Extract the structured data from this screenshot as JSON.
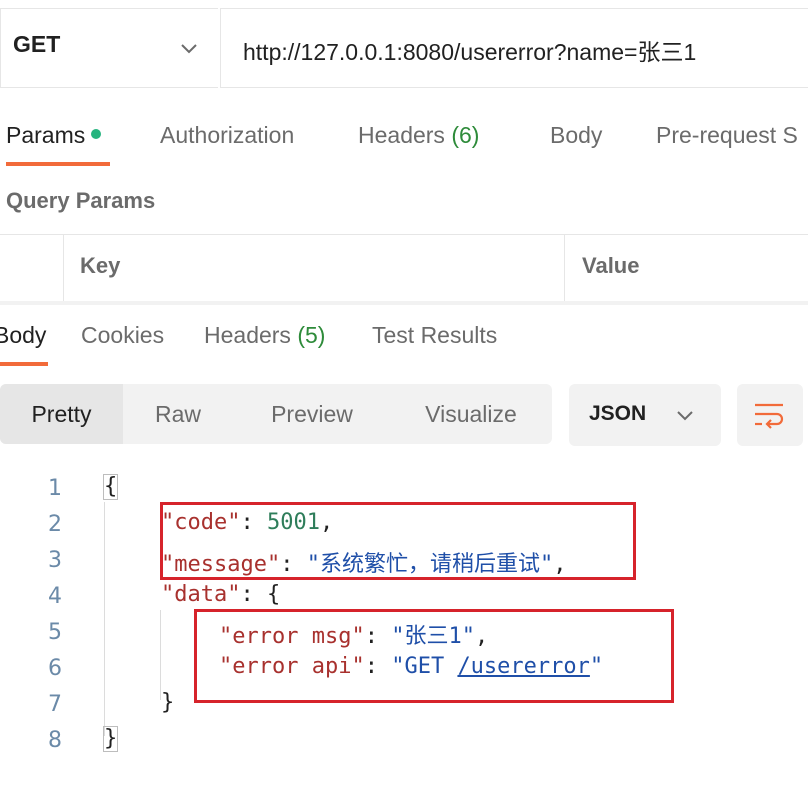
{
  "request": {
    "method": "GET",
    "url": "http://127.0.0.1:8080/usererror?name=张三1"
  },
  "request_tabs": [
    {
      "label": "Params",
      "active": true
    },
    {
      "label": "Authorization"
    },
    {
      "label": "Headers",
      "count": "(6)"
    },
    {
      "label": "Body"
    },
    {
      "label": "Pre-request S"
    }
  ],
  "query_params": {
    "title": "Query Params",
    "columns": [
      "Key",
      "Value"
    ]
  },
  "response_tabs": [
    {
      "label": "Body",
      "active": true
    },
    {
      "label": "Cookies"
    },
    {
      "label": "Headers",
      "count": "(5)"
    },
    {
      "label": "Test Results"
    }
  ],
  "view_modes": [
    "Pretty",
    "Raw",
    "Preview",
    "Visualize"
  ],
  "format": "JSON",
  "response_body": {
    "line_numbers": [
      "1",
      "2",
      "3",
      "4",
      "5",
      "6",
      "7",
      "8"
    ],
    "code_key": "\"code\"",
    "code_value": "5001",
    "message_key": "\"message\"",
    "message_value": "\"系统繁忙，请稍后重试\"",
    "data_key": "\"data\"",
    "error_msg_key": "\"error msg\"",
    "error_msg_value": "\"张三1\"",
    "error_api_key": "\"error api\"",
    "error_api_value_prefix": "\"GET ",
    "error_api_value_link": "/usererror",
    "error_api_value_suffix": "\""
  },
  "colors": {
    "accent": "#f26b3a",
    "highlight_box": "#d6232b",
    "params_dot": "#26b47f"
  }
}
